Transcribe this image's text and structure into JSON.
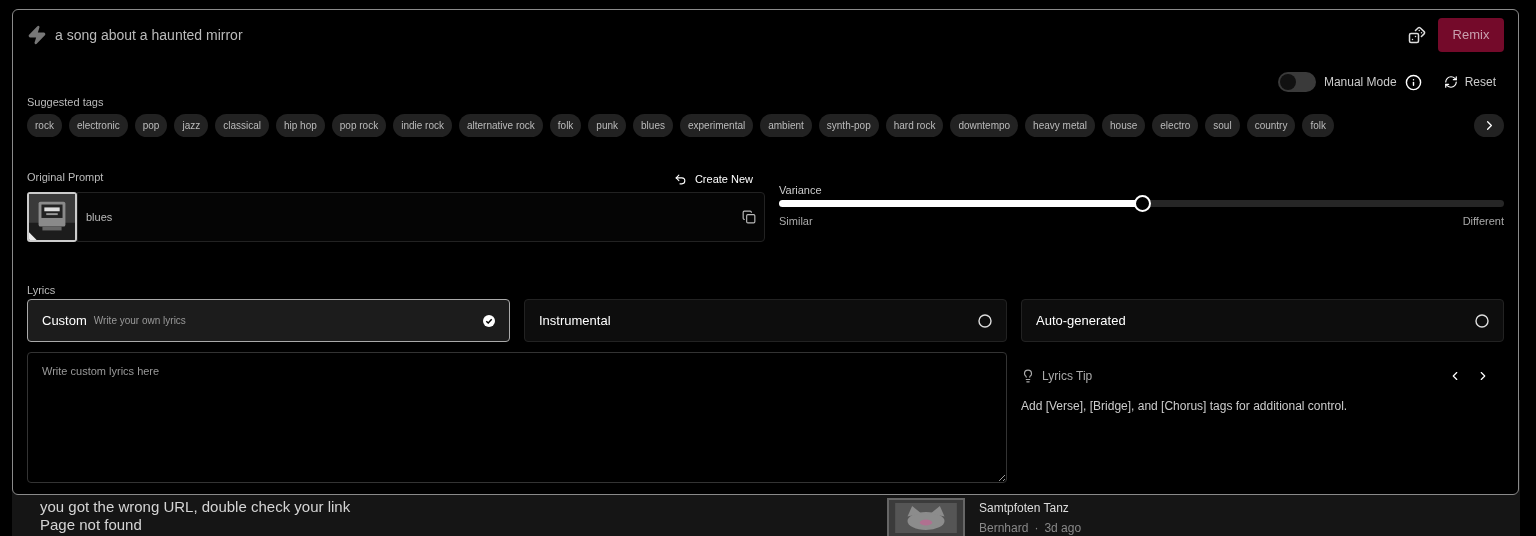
{
  "prompt": {
    "text": "a song about a haunted mirror"
  },
  "remix_button": "Remix",
  "manual_mode": {
    "label": "Manual Mode",
    "on": false
  },
  "reset_button": "Reset",
  "suggested_tags": {
    "label": "Suggested tags",
    "tags": [
      "rock",
      "electronic",
      "pop",
      "jazz",
      "classical",
      "hip hop",
      "pop rock",
      "indie rock",
      "alternative rock",
      "folk",
      "punk",
      "blues",
      "experimental",
      "ambient",
      "synth-pop",
      "hard rock",
      "downtempo",
      "heavy metal",
      "house",
      "electro",
      "soul",
      "country",
      "folk"
    ]
  },
  "original_prompt": {
    "label": "Original Prompt",
    "create_new": "Create New",
    "text": "blues"
  },
  "variance": {
    "label": "Variance",
    "level": 0.5,
    "min_label": "Similar",
    "max_label": "Different"
  },
  "lyrics": {
    "label": "Lyrics",
    "options": [
      {
        "label": "Custom",
        "hint": "Write your own lyrics",
        "selected": true
      },
      {
        "label": "Instrumental",
        "selected": false
      },
      {
        "label": "Auto-generated",
        "selected": false
      }
    ],
    "placeholder": "Write custom lyrics here"
  },
  "lyrics_tip": {
    "title": "Lyrics Tip",
    "text": "Add [Verse], [Bridge], and [Chorus] tags for additional control."
  },
  "background": {
    "lines": [
      "you got the wrong URL, double check your link",
      "Page not found"
    ],
    "song": {
      "title": "Samtpfoten Tanz",
      "author": "Bernhard",
      "separator": "·",
      "age": "3d ago"
    }
  }
}
